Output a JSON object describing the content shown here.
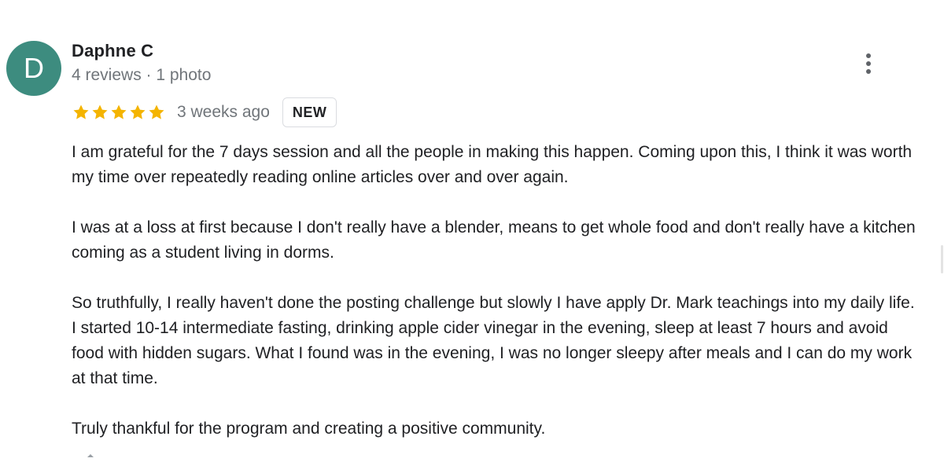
{
  "review": {
    "avatar_initial": "D",
    "avatar_color": "#3d8c7f",
    "author_name": "Daphne C",
    "author_meta": "4 reviews · 1 photo",
    "rating": 5,
    "rating_max": 5,
    "star_color": "#f4b400",
    "date": "3 weeks ago",
    "badge": "NEW",
    "paragraphs": [
      "I am grateful for the 7 days session and all the people in making this happen. Coming upon this, I think it was worth my time over repeatedly reading online articles over and over again.",
      "I was at a loss at first because I don't really have a blender, means to get whole food and don't really have a kitchen coming as a student living in dorms.",
      "So truthfully, I really haven't done the posting challenge but slowly I have apply Dr. Mark teachings into my daily life. I started 10-14 intermediate fasting, drinking apple cider vinegar in the evening, sleep at least 7 hours and avoid food with hidden sugars. What I found was in the evening, I was no longer sleepy after meals and I can do my work at that time.",
      "Truly thankful for the program and creating a positive community."
    ],
    "more_icon": "more-vert-icon"
  }
}
